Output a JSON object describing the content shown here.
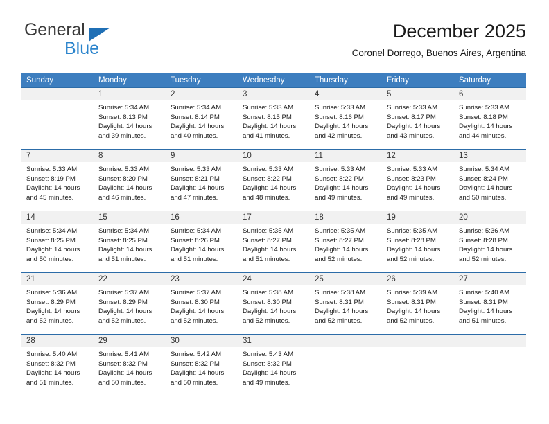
{
  "brand": {
    "name_dark": "General",
    "name_blue": "Blue",
    "triangle_color": "#1f6fb5",
    "blue_color": "#2b84cc"
  },
  "header": {
    "title": "December 2025",
    "subtitle": "Coronel Dorrego, Buenos Aires, Argentina"
  },
  "theme": {
    "header_bg": "#3d7ebf",
    "row_divider": "#2c6ca8",
    "day_number_bg": "#f1f1f1"
  },
  "calendar": {
    "weekdays": [
      "Sunday",
      "Monday",
      "Tuesday",
      "Wednesday",
      "Thursday",
      "Friday",
      "Saturday"
    ],
    "weeks": [
      [
        {
          "day": "",
          "sunrise": "",
          "sunset": "",
          "daylight_1": "",
          "daylight_2": ""
        },
        {
          "day": "1",
          "sunrise": "Sunrise: 5:34 AM",
          "sunset": "Sunset: 8:13 PM",
          "daylight_1": "Daylight: 14 hours",
          "daylight_2": "and 39 minutes."
        },
        {
          "day": "2",
          "sunrise": "Sunrise: 5:34 AM",
          "sunset": "Sunset: 8:14 PM",
          "daylight_1": "Daylight: 14 hours",
          "daylight_2": "and 40 minutes."
        },
        {
          "day": "3",
          "sunrise": "Sunrise: 5:33 AM",
          "sunset": "Sunset: 8:15 PM",
          "daylight_1": "Daylight: 14 hours",
          "daylight_2": "and 41 minutes."
        },
        {
          "day": "4",
          "sunrise": "Sunrise: 5:33 AM",
          "sunset": "Sunset: 8:16 PM",
          "daylight_1": "Daylight: 14 hours",
          "daylight_2": "and 42 minutes."
        },
        {
          "day": "5",
          "sunrise": "Sunrise: 5:33 AM",
          "sunset": "Sunset: 8:17 PM",
          "daylight_1": "Daylight: 14 hours",
          "daylight_2": "and 43 minutes."
        },
        {
          "day": "6",
          "sunrise": "Sunrise: 5:33 AM",
          "sunset": "Sunset: 8:18 PM",
          "daylight_1": "Daylight: 14 hours",
          "daylight_2": "and 44 minutes."
        }
      ],
      [
        {
          "day": "7",
          "sunrise": "Sunrise: 5:33 AM",
          "sunset": "Sunset: 8:19 PM",
          "daylight_1": "Daylight: 14 hours",
          "daylight_2": "and 45 minutes."
        },
        {
          "day": "8",
          "sunrise": "Sunrise: 5:33 AM",
          "sunset": "Sunset: 8:20 PM",
          "daylight_1": "Daylight: 14 hours",
          "daylight_2": "and 46 minutes."
        },
        {
          "day": "9",
          "sunrise": "Sunrise: 5:33 AM",
          "sunset": "Sunset: 8:21 PM",
          "daylight_1": "Daylight: 14 hours",
          "daylight_2": "and 47 minutes."
        },
        {
          "day": "10",
          "sunrise": "Sunrise: 5:33 AM",
          "sunset": "Sunset: 8:22 PM",
          "daylight_1": "Daylight: 14 hours",
          "daylight_2": "and 48 minutes."
        },
        {
          "day": "11",
          "sunrise": "Sunrise: 5:33 AM",
          "sunset": "Sunset: 8:22 PM",
          "daylight_1": "Daylight: 14 hours",
          "daylight_2": "and 49 minutes."
        },
        {
          "day": "12",
          "sunrise": "Sunrise: 5:33 AM",
          "sunset": "Sunset: 8:23 PM",
          "daylight_1": "Daylight: 14 hours",
          "daylight_2": "and 49 minutes."
        },
        {
          "day": "13",
          "sunrise": "Sunrise: 5:34 AM",
          "sunset": "Sunset: 8:24 PM",
          "daylight_1": "Daylight: 14 hours",
          "daylight_2": "and 50 minutes."
        }
      ],
      [
        {
          "day": "14",
          "sunrise": "Sunrise: 5:34 AM",
          "sunset": "Sunset: 8:25 PM",
          "daylight_1": "Daylight: 14 hours",
          "daylight_2": "and 50 minutes."
        },
        {
          "day": "15",
          "sunrise": "Sunrise: 5:34 AM",
          "sunset": "Sunset: 8:25 PM",
          "daylight_1": "Daylight: 14 hours",
          "daylight_2": "and 51 minutes."
        },
        {
          "day": "16",
          "sunrise": "Sunrise: 5:34 AM",
          "sunset": "Sunset: 8:26 PM",
          "daylight_1": "Daylight: 14 hours",
          "daylight_2": "and 51 minutes."
        },
        {
          "day": "17",
          "sunrise": "Sunrise: 5:35 AM",
          "sunset": "Sunset: 8:27 PM",
          "daylight_1": "Daylight: 14 hours",
          "daylight_2": "and 51 minutes."
        },
        {
          "day": "18",
          "sunrise": "Sunrise: 5:35 AM",
          "sunset": "Sunset: 8:27 PM",
          "daylight_1": "Daylight: 14 hours",
          "daylight_2": "and 52 minutes."
        },
        {
          "day": "19",
          "sunrise": "Sunrise: 5:35 AM",
          "sunset": "Sunset: 8:28 PM",
          "daylight_1": "Daylight: 14 hours",
          "daylight_2": "and 52 minutes."
        },
        {
          "day": "20",
          "sunrise": "Sunrise: 5:36 AM",
          "sunset": "Sunset: 8:28 PM",
          "daylight_1": "Daylight: 14 hours",
          "daylight_2": "and 52 minutes."
        }
      ],
      [
        {
          "day": "21",
          "sunrise": "Sunrise: 5:36 AM",
          "sunset": "Sunset: 8:29 PM",
          "daylight_1": "Daylight: 14 hours",
          "daylight_2": "and 52 minutes."
        },
        {
          "day": "22",
          "sunrise": "Sunrise: 5:37 AM",
          "sunset": "Sunset: 8:29 PM",
          "daylight_1": "Daylight: 14 hours",
          "daylight_2": "and 52 minutes."
        },
        {
          "day": "23",
          "sunrise": "Sunrise: 5:37 AM",
          "sunset": "Sunset: 8:30 PM",
          "daylight_1": "Daylight: 14 hours",
          "daylight_2": "and 52 minutes."
        },
        {
          "day": "24",
          "sunrise": "Sunrise: 5:38 AM",
          "sunset": "Sunset: 8:30 PM",
          "daylight_1": "Daylight: 14 hours",
          "daylight_2": "and 52 minutes."
        },
        {
          "day": "25",
          "sunrise": "Sunrise: 5:38 AM",
          "sunset": "Sunset: 8:31 PM",
          "daylight_1": "Daylight: 14 hours",
          "daylight_2": "and 52 minutes."
        },
        {
          "day": "26",
          "sunrise": "Sunrise: 5:39 AM",
          "sunset": "Sunset: 8:31 PM",
          "daylight_1": "Daylight: 14 hours",
          "daylight_2": "and 52 minutes."
        },
        {
          "day": "27",
          "sunrise": "Sunrise: 5:40 AM",
          "sunset": "Sunset: 8:31 PM",
          "daylight_1": "Daylight: 14 hours",
          "daylight_2": "and 51 minutes."
        }
      ],
      [
        {
          "day": "28",
          "sunrise": "Sunrise: 5:40 AM",
          "sunset": "Sunset: 8:32 PM",
          "daylight_1": "Daylight: 14 hours",
          "daylight_2": "and 51 minutes."
        },
        {
          "day": "29",
          "sunrise": "Sunrise: 5:41 AM",
          "sunset": "Sunset: 8:32 PM",
          "daylight_1": "Daylight: 14 hours",
          "daylight_2": "and 50 minutes."
        },
        {
          "day": "30",
          "sunrise": "Sunrise: 5:42 AM",
          "sunset": "Sunset: 8:32 PM",
          "daylight_1": "Daylight: 14 hours",
          "daylight_2": "and 50 minutes."
        },
        {
          "day": "31",
          "sunrise": "Sunrise: 5:43 AM",
          "sunset": "Sunset: 8:32 PM",
          "daylight_1": "Daylight: 14 hours",
          "daylight_2": "and 49 minutes."
        },
        {
          "day": "",
          "sunrise": "",
          "sunset": "",
          "daylight_1": "",
          "daylight_2": ""
        },
        {
          "day": "",
          "sunrise": "",
          "sunset": "",
          "daylight_1": "",
          "daylight_2": ""
        },
        {
          "day": "",
          "sunrise": "",
          "sunset": "",
          "daylight_1": "",
          "daylight_2": ""
        }
      ]
    ]
  }
}
